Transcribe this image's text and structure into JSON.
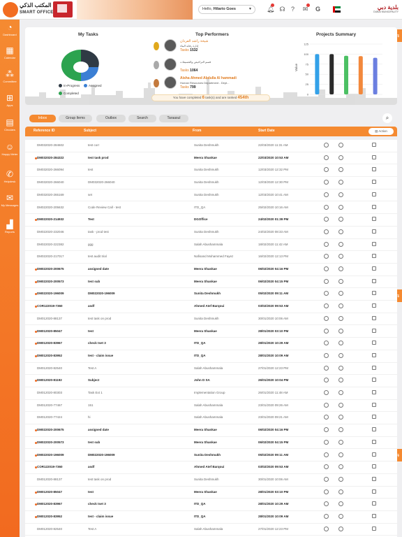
{
  "header": {
    "app_name_ar": "المكتب الذكي",
    "app_name_en": "SMART OFFICE",
    "greeting_prefix": "Hello,",
    "user_name": "Hilario Goes",
    "municipality_ar": "بلدية دبي",
    "municipality_en": "DUBAI MUNICIPALITY"
  },
  "sidebar": {
    "items": [
      {
        "label": "Dashboard",
        "icon": "dashboard-icon"
      },
      {
        "label": "Calendar",
        "icon": "calendar-icon"
      },
      {
        "label": "Committee",
        "icon": "committee-icon"
      },
      {
        "label": "Apps",
        "icon": "apps-icon"
      },
      {
        "label": "Circulars",
        "icon": "circulars-icon"
      },
      {
        "label": "Happy Meter",
        "icon": "smiley-icon"
      },
      {
        "label": "Helpdesk",
        "icon": "phone-icon"
      },
      {
        "label": "My Messages",
        "icon": "envelope-icon"
      },
      {
        "label": "Reports",
        "icon": "bar-chart-icon"
      }
    ]
  },
  "my_tasks": {
    "title": "My Tasks",
    "legend": [
      "In-Progress",
      "Assigned",
      "Completed"
    ],
    "colors": [
      "#2f3a44",
      "#3b7fd4",
      "#2ca34f"
    ]
  },
  "top_performers": {
    "title": "Top Performers",
    "tasks_label": "Tasks",
    "people": [
      {
        "name": "شيخة راشد الفردان",
        "dept": "إدارة رقابة البناء",
        "tasks": "1532",
        "medal": "#e0a81c"
      },
      {
        "name": "",
        "dept": "قسم التراخيص والتصنيفات",
        "tasks": "1064",
        "medal": "#a9a9a9"
      },
      {
        "name": "Aisha Ahmed Abdulla Al hammadi",
        "dept": "Human Resources Department - Dept...",
        "tasks": "799",
        "medal": "#c47a3d"
      }
    ],
    "banner_prefix": "You have completed",
    "banner_count": "6",
    "banner_middle": "task(s) and are ranked",
    "banner_rank": "454th"
  },
  "projects_summary": {
    "title": "Projects Summary",
    "ylabel": "Value"
  },
  "chart_data": {
    "type": "bar",
    "title": "Projects Summary",
    "ylabel": "Value",
    "ylim": [
      0,
      125
    ],
    "yticks": [
      0,
      25,
      50,
      75,
      100,
      125
    ],
    "categories": [
      "",
      "",
      "",
      "",
      ""
    ],
    "values": [
      100,
      100,
      96,
      95,
      91
    ],
    "colors": [
      "#33a1e8",
      "#2b2b2b",
      "#4cc064",
      "#f2883c",
      "#6b7fe0"
    ]
  },
  "tabs": [
    "Inbox",
    "Group Items",
    "Outbox",
    "Search",
    "Taraasul"
  ],
  "table": {
    "headers": [
      "Reference ID",
      "Subject",
      "From",
      "Start Date"
    ],
    "action_label": "Action",
    "rows": [
      {
        "ref": "DM032020-284602",
        "subject": "test corr",
        "from": "Sunita Deshmukh",
        "date": "22/03/2020 11:31 AM",
        "unread": false
      },
      {
        "ref": "DM032020-284322",
        "subject": "test task prod",
        "from": "Meera Shankae",
        "date": "22/03/2020 10:53 AM",
        "unread": true
      },
      {
        "ref": "DM032020-266094",
        "subject": "test",
        "from": "Sunita Deshmukh",
        "date": "12/03/2020 12:32 PM",
        "unread": false
      },
      {
        "ref": "DM032020-266040",
        "subject": "DM032020-266040",
        "from": "Sunita Deshmukh",
        "date": "12/03/2020 12:30 PM",
        "unread": false
      },
      {
        "ref": "DM032020-265169",
        "subject": "set",
        "from": "Sunita Deshmukh",
        "date": "12/03/2020 10:41 AM",
        "unread": false
      },
      {
        "ref": "DM022020-205632",
        "subject": "Code Review Call - test",
        "from": "ITD_QA",
        "date": "25/02/2020 10:16 AM",
        "unread": false
      },
      {
        "ref": "DM022020-214932",
        "subject": "Test",
        "from": "DGOffice",
        "date": "24/02/2020 01:39 PM",
        "unread": true
      },
      {
        "ref": "DM022020-232046",
        "subject": "task - prod test",
        "from": "Sunita Deshmukh",
        "date": "24/02/2020 08:33 AM",
        "unread": false
      },
      {
        "ref": "DM022020-222382",
        "subject": "ggg",
        "from": "Salah Abushammala",
        "date": "18/02/2020 11:42 AM",
        "unread": false
      },
      {
        "ref": "DM022020-217017",
        "subject": "test audit trial",
        "from": "Nafisand Mohammed Fayez",
        "date": "16/02/2020 12:13 PM",
        "unread": false
      },
      {
        "ref": "DM022020-200675",
        "subject": "assigned date",
        "from": "Meera Shankae",
        "date": "06/02/2020 04:16 PM",
        "unread": true
      },
      {
        "ref": "DM022020-200573",
        "subject": "test sub",
        "from": "Meera Shankae",
        "date": "06/02/2020 04:15 PM",
        "unread": true
      },
      {
        "ref": "DM022020-196009",
        "subject": "DM022020-196009",
        "from": "Sunita Deshmukh",
        "date": "05/02/2020 09:11 AM",
        "unread": true
      },
      {
        "ref": "COR122019-7360",
        "subject": "asdf",
        "from": "Ahmed Atef Barqoui",
        "date": "03/02/2020 09:53 AM",
        "unread": true
      },
      {
        "ref": "DM012020-88137",
        "subject": "test task on prod",
        "from": "Sunita Deshmukh",
        "date": "30/01/2020 10:06 AM",
        "unread": false
      },
      {
        "ref": "DM012020-85047",
        "subject": "test",
        "from": "Meera Shankae",
        "date": "28/01/2020 03:10 PM",
        "unread": true
      },
      {
        "ref": "DM012020-83967",
        "subject": "check tset 3",
        "from": "ITD_QA",
        "date": "28/01/2020 10:29 AM",
        "unread": true
      },
      {
        "ref": "DM012020-83952",
        "subject": "test - claim issue",
        "from": "ITD_QA",
        "date": "28/01/2020 10:09 AM",
        "unread": true
      },
      {
        "ref": "DM012020-82540",
        "subject": "Test A",
        "from": "Salah Abushammala",
        "date": "27/01/2020 12:23 PM",
        "unread": false
      },
      {
        "ref": "DM012020-81192",
        "subject": "Subject",
        "from": "John D SA",
        "date": "26/01/2020 10:04 PM",
        "unread": true
      },
      {
        "ref": "DM012020-80303",
        "subject": "Task Ext 1",
        "from": "Implementation Group",
        "date": "26/01/2020 11:48 AM",
        "unread": false
      },
      {
        "ref": "DM012020-77467",
        "subject": "151",
        "from": "Salah Abushammala",
        "date": "23/01/2020 09:26 AM",
        "unread": false
      },
      {
        "ref": "DM012020-77424",
        "subject": "hi",
        "from": "Salah Abushammala",
        "date": "23/01/2020 09:21 AM",
        "unread": false
      },
      {
        "ref": "DM022020-200675",
        "subject": "assigned date",
        "from": "Meera Shankae",
        "date": "06/02/2020 04:16 PM",
        "unread": true
      },
      {
        "ref": "DM022020-200573",
        "subject": "test sub",
        "from": "Meera Shankae",
        "date": "06/02/2020 04:15 PM",
        "unread": true
      },
      {
        "ref": "DM022020-196009",
        "subject": "DM022020-196009",
        "from": "Sunita Deshmukh",
        "date": "05/02/2020 09:11 AM",
        "unread": true
      },
      {
        "ref": "COR122019-7360",
        "subject": "asdf",
        "from": "Ahmed Atef Barqoui",
        "date": "03/02/2020 09:53 AM",
        "unread": true
      },
      {
        "ref": "DM012020-88137",
        "subject": "test task on prod",
        "from": "Sunita Deshmukh",
        "date": "30/01/2020 10:06 AM",
        "unread": false
      },
      {
        "ref": "DM012020-85047",
        "subject": "test",
        "from": "Meera Shankae",
        "date": "28/01/2020 03:10 PM",
        "unread": true
      },
      {
        "ref": "DM012020-83967",
        "subject": "check tset 3",
        "from": "ITD_QA",
        "date": "28/01/2020 10:29 AM",
        "unread": true
      },
      {
        "ref": "DM012020-83952",
        "subject": "test - claim issue",
        "from": "ITD_QA",
        "date": "28/01/2020 10:09 AM",
        "unread": true
      },
      {
        "ref": "DM012020-82540",
        "subject": "Test A",
        "from": "Salah Abushammala",
        "date": "27/01/2020 12:23 PM",
        "unread": false
      }
    ]
  }
}
